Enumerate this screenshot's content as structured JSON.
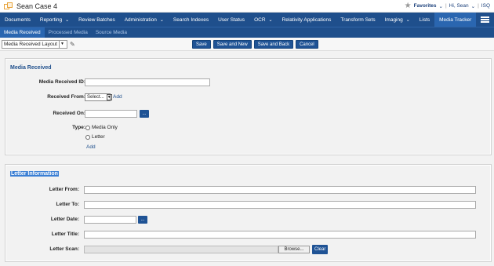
{
  "app": {
    "case_title": "Sean Case 4",
    "favorites": "Favorites",
    "greeting": "Hi, Sean",
    "search_short": "ISQ"
  },
  "nav": {
    "items": [
      {
        "label": "Documents",
        "has_menu": false
      },
      {
        "label": "Reporting",
        "has_menu": true
      },
      {
        "label": "Review Batches",
        "has_menu": false
      },
      {
        "label": "Administration",
        "has_menu": true
      },
      {
        "label": "Search Indexes",
        "has_menu": false
      },
      {
        "label": "User Status",
        "has_menu": false
      },
      {
        "label": "OCR",
        "has_menu": true
      },
      {
        "label": "Relativity Applications",
        "has_menu": false
      },
      {
        "label": "Transform Sets",
        "has_menu": false
      },
      {
        "label": "Imaging",
        "has_menu": true
      },
      {
        "label": "Lists",
        "has_menu": false
      },
      {
        "label": "Media Tracker",
        "has_menu": false,
        "active": true
      }
    ]
  },
  "subnav": {
    "items": [
      "Media Received",
      "Processed Media",
      "Source Media"
    ],
    "active": "Media Received"
  },
  "toolbar": {
    "layout_value": "Media Received Layout",
    "save": "Save",
    "save_new": "Save and New",
    "save_back": "Save and Back",
    "cancel": "Cancel"
  },
  "media_received": {
    "title": "Media Received",
    "id_label": "Media Received ID:",
    "from_label": "Received From:",
    "from_select": "Select...",
    "from_add": "Add",
    "on_label": "Received On:",
    "type_label": "Type:",
    "type_options": [
      "Media Only",
      "Letter"
    ],
    "type_add": "Add",
    "calendar_btn": "..."
  },
  "letter": {
    "title": "Letter Information",
    "from_label": "Letter From:",
    "to_label": "Letter To:",
    "date_label": "Letter Date:",
    "title_label": "Letter Title:",
    "scan_label": "Letter Scan:",
    "browse": "Browse...",
    "clear": "Clear",
    "calendar_btn": "..."
  },
  "colors": {
    "nav_bg": "#1f4f8c",
    "active_tab": "#2a66b0",
    "button": "#1f5395",
    "accent_orange": "#e8a33a"
  }
}
